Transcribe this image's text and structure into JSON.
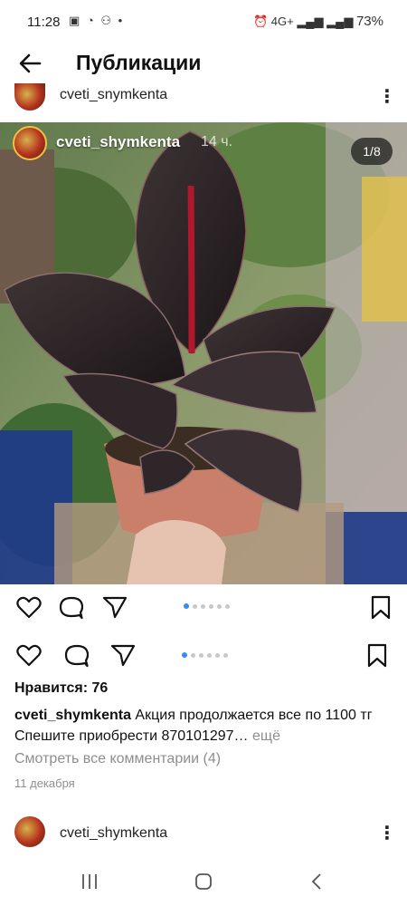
{
  "status_bar": {
    "time": "11:28",
    "left_icons": "▣ ◔ ⚇ •",
    "right_icons": "⏰ 4G+ ▂▄▆ ▂▄▆",
    "battery": "73%"
  },
  "header": {
    "title": "Публикации"
  },
  "post_top": {
    "username": "cveti_snymkenta"
  },
  "post": {
    "overlay_username": "cveti_shymkenta",
    "overlay_time": "14 ч.",
    "image_counter": "1/8",
    "likes": "Нравится: 76",
    "caption_user": "cveti_shymkenta",
    "caption_text": "Акция продолжается все по 1100 тг Спешите приобрести 870101297…",
    "caption_more": "ещё",
    "view_comments": "Смотреть все комментарии (4)",
    "date": "11 декабря"
  },
  "post_next": {
    "username": "cveti_shymkenta"
  },
  "colors": {
    "accent_dot": "#2f8df5",
    "muted_text": "#8e8e8e"
  }
}
